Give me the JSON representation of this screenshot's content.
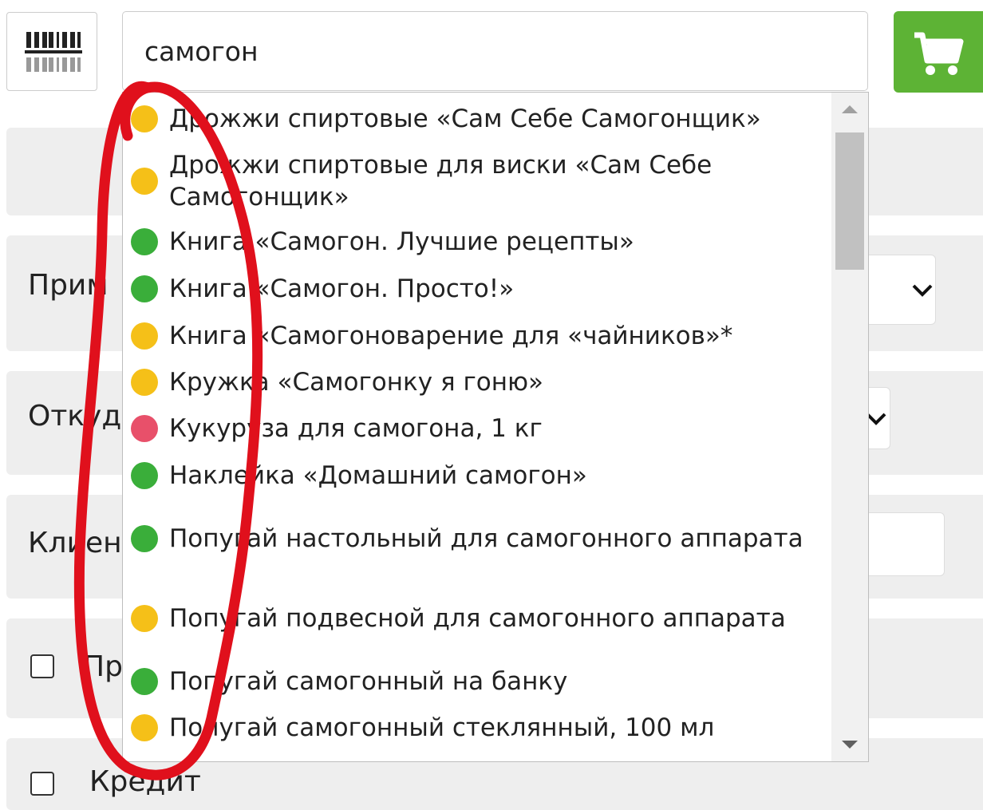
{
  "search": {
    "value": "самогон"
  },
  "form": {
    "row1_label": "Прим",
    "row2_label": "Откуд",
    "row3_label": "Клиен",
    "row4_label": "Пр",
    "row5_label": "Кредит"
  },
  "dropdown": {
    "items": [
      {
        "label": "Дрожжи спиртовые «Сам Себе Самогонщик»",
        "status_color": "#f5c018"
      },
      {
        "label": "Дрожжи спиртовые для виски «Сам Себе Самогонщик»",
        "status_color": "#f5c018"
      },
      {
        "label": "Книга «Самогон. Лучшие рецепты»",
        "status_color": "#3aae3a"
      },
      {
        "label": "Книга «Самогон. Просто!»",
        "status_color": "#3aae3a"
      },
      {
        "label": "Книга «Самогоноварение для «чайников»*",
        "status_color": "#f5c018"
      },
      {
        "label": "Кружка «Самогонку я гоню»",
        "status_color": "#f5c018"
      },
      {
        "label": "Кукуруза для самогона, 1 кг",
        "status_color": "#e8506a"
      },
      {
        "label": "Наклейка «Домашний самогон»",
        "status_color": "#3aae3a"
      },
      {
        "label": "Попугай настольный для самогонного аппарата",
        "status_color": "#3aae3a"
      },
      {
        "label": "Попугай подвесной для самогонного аппарата",
        "status_color": "#f5c018"
      },
      {
        "label": "Попугай самогонный на банку",
        "status_color": "#3aae3a"
      },
      {
        "label": "Попугай самогонный стеклянный, 100 мл",
        "status_color": "#f5c018"
      }
    ]
  },
  "colors": {
    "cart_button": "#5db335",
    "annotation": "#e0101c"
  },
  "icons": {
    "barcode": "barcode-icon",
    "cart": "cart-icon",
    "chevron": "chevron-down-icon"
  }
}
